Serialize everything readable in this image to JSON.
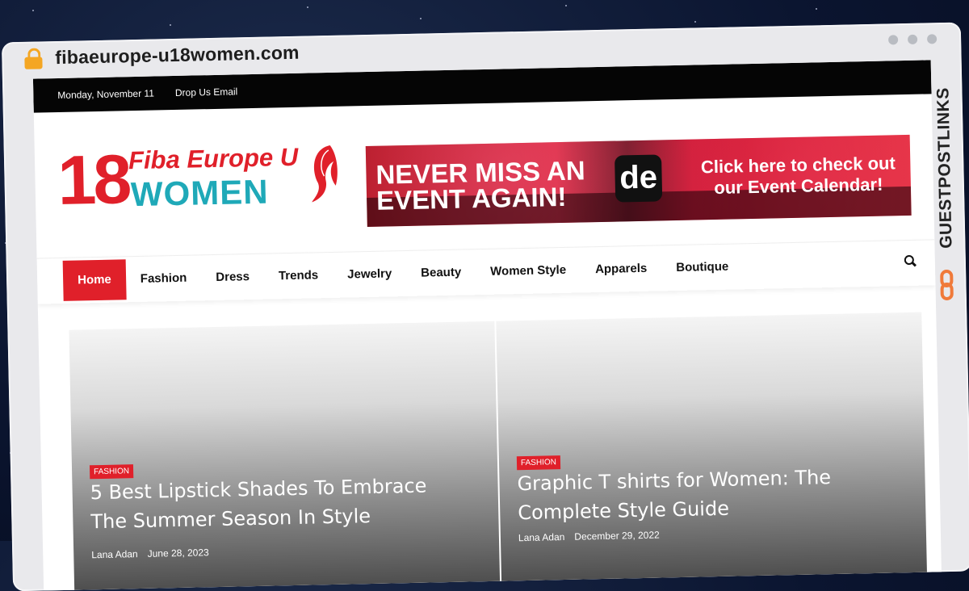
{
  "browser": {
    "url": "fibaeurope-u18women.com",
    "side_brand": "GUESTPOSTLINKS"
  },
  "topbar": {
    "date": "Monday, November 11",
    "email_link": "Drop Us Email"
  },
  "logo": {
    "number": "18",
    "line1": "Fiba Europe U",
    "line2": "WOMEN"
  },
  "banner": {
    "headline": "NEVER MISS AN EVENT AGAIN!",
    "brand_mark": "de",
    "cta": "Click here to check out our Event Calendar!"
  },
  "nav": {
    "items": [
      {
        "label": "Home"
      },
      {
        "label": "Fashion"
      },
      {
        "label": "Dress"
      },
      {
        "label": "Trends"
      },
      {
        "label": "Jewelry"
      },
      {
        "label": "Beauty"
      },
      {
        "label": "Women Style"
      },
      {
        "label": "Apparels"
      },
      {
        "label": "Boutique"
      }
    ],
    "active_index": 0
  },
  "posts": [
    {
      "category": "FASHION",
      "title": "5 Best Lipstick Shades To Embrace The Summer Season In Style",
      "author": "Lana Adan",
      "date": "June 28, 2023"
    },
    {
      "category": "FASHION",
      "title": "Graphic T shirts for Women: The Complete Style Guide",
      "author": "Lana Adan",
      "date": "December 29, 2022"
    }
  ],
  "colors": {
    "accent": "#e0202a",
    "logo_teal": "#1fa9b8",
    "topbar": "#050505",
    "side_brand_accent": "#f07a3a"
  },
  "icons": [
    "lock-icon",
    "search-icon",
    "hair-silhouette-icon",
    "link-icon"
  ]
}
